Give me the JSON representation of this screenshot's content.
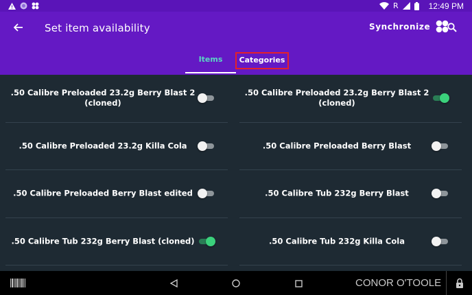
{
  "status_bar": {
    "time": "12:49 PM",
    "network_label": "R",
    "icons": [
      "warning-icon",
      "circle-app-icon",
      "grid-app-icon",
      "wifi-icon",
      "signal-icon",
      "battery-icon"
    ]
  },
  "app_bar": {
    "title": "Set item availability",
    "sync_label": "Synchronize",
    "background_color": "#6419c4"
  },
  "tabs": [
    {
      "label": "Items",
      "active": true
    },
    {
      "label": "Categories",
      "active": false,
      "highlighted": true
    }
  ],
  "items": {
    "left": [
      {
        "label": ".50 Calibre Preloaded 23.2g Berry Blast 2 (cloned)",
        "enabled": false
      },
      {
        "label": ".50 Calibre Preloaded 23.2g Killa Cola",
        "enabled": false
      },
      {
        "label": ".50 Calibre Preloaded Berry Blast edited",
        "enabled": false
      },
      {
        "label": ".50 Calibre Tub 232g Berry Blast (cloned)",
        "enabled": true
      }
    ],
    "right": [
      {
        "label": ".50 Calibre Preloaded 23.2g Berry Blast 2 (cloned)",
        "enabled": true
      },
      {
        "label": ".50 Calibre Preloaded Berry Blast",
        "enabled": false
      },
      {
        "label": ".50 Calibre Tub 232g Berry Blast",
        "enabled": false
      },
      {
        "label": ".50 Calibre Tub 232g Killa Cola",
        "enabled": false
      }
    ]
  },
  "nav_bar": {
    "user_name": "CONOR O'TOOLE"
  },
  "colors": {
    "toggle_on": "#3bd17c",
    "toggle_off": "#8e959a",
    "active_tab": "#59d6c4",
    "highlight_border": "#e5202a"
  }
}
